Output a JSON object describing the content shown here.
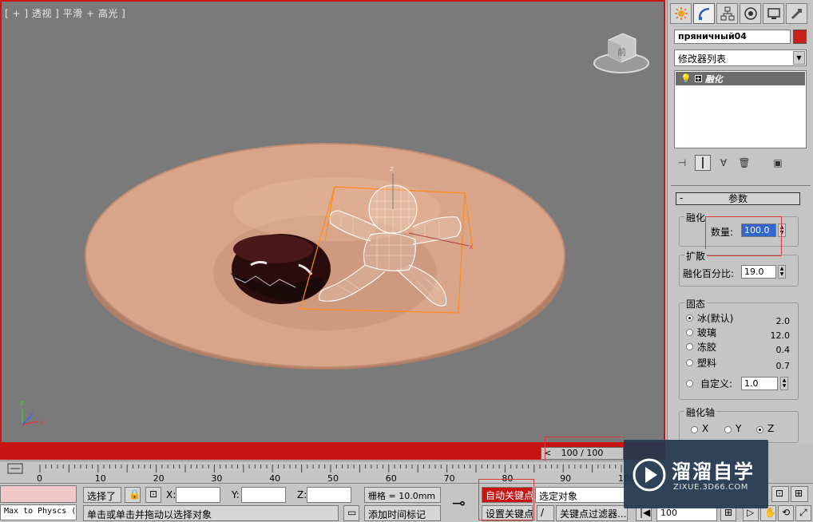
{
  "viewport": {
    "label": "[ + ] 透视 ] 平滑 + 高光 ]",
    "axis_gizmo": {
      "x": "x",
      "y": "y",
      "z": "z"
    },
    "viewcube_face": "前"
  },
  "command_panel": {
    "tabs": [
      "create-icon",
      "modify-icon",
      "hierarchy-icon",
      "motion-icon",
      "display-icon",
      "utilities-icon"
    ],
    "object_name": "пряничный04",
    "object_color": "#c8201c",
    "modifier_list": "修改器列表",
    "stack_item": "融化",
    "rollout_title": "参数",
    "melt_group": {
      "title": "融化",
      "amount_label": "数量:",
      "amount_value": "100.0"
    },
    "spread_group": {
      "title": "扩散",
      "percent_label": "融化百分比:",
      "percent_value": "19.0"
    },
    "solidity_group": {
      "title": "固态",
      "options": [
        {
          "label": "冰(默认)",
          "value": "2.0",
          "selected": true
        },
        {
          "label": "玻璃",
          "value": "12.0",
          "selected": false
        },
        {
          "label": "冻胶",
          "value": "0.4",
          "selected": false
        },
        {
          "label": "塑料",
          "value": "0.7",
          "selected": false
        }
      ],
      "custom_label": "自定义:",
      "custom_value": "1.0"
    },
    "axis_group": {
      "title": "融化轴",
      "x": "X",
      "y": "Y",
      "z": "Z",
      "selected": "Z"
    }
  },
  "timeline": {
    "slider_text": "100 / 100",
    "prev": "<",
    "ticks": [
      "0",
      "10",
      "20",
      "30",
      "40",
      "50",
      "60",
      "70",
      "80",
      "90",
      "100"
    ]
  },
  "status": {
    "maxscript": "Max to Physcs (",
    "selected": "选择了",
    "x_label": "X:",
    "y_label": "Y:",
    "z_label": "Z:",
    "grid": "栅格 = 10.0mm",
    "prompt": "单击或单击并拖动以选择对象",
    "add_time_tag": "添加时间标记",
    "auto_key": "自动关键点",
    "set_key": "设置关键点",
    "selection_set": "选定对象",
    "key_filters": "关键点过滤器...",
    "frame": "100"
  },
  "watermark": {
    "title": "溜溜自学",
    "subtitle": "ZIXUE.3D66.COM"
  },
  "colors": {
    "viewport_bg": "#7a7a7a",
    "plate": "#d9a58a",
    "active_red": "#c81414",
    "panel_bg": "#c5c5c5"
  }
}
